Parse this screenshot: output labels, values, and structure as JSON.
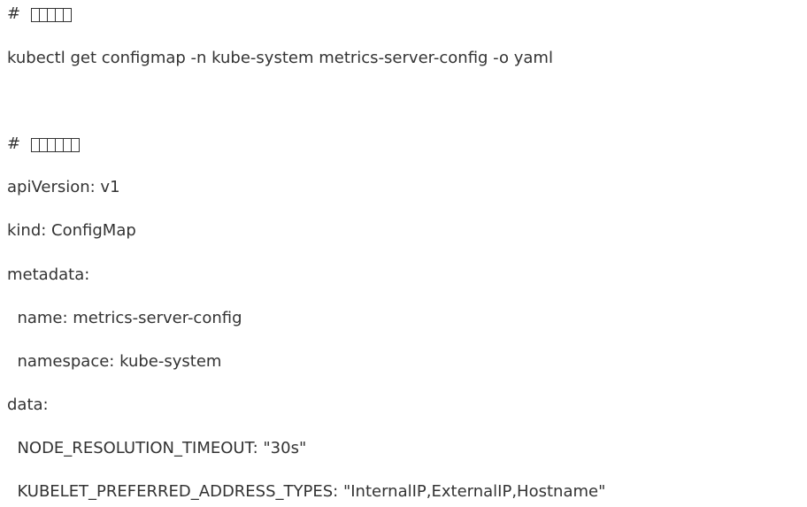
{
  "document": {
    "lines": [
      "# ",
      "kubectl get configmap -n kube-system metrics-server-config -o yaml",
      "",
      "# ",
      "apiVersion: v1",
      "kind: ConfigMap",
      "metadata:",
      "  name: metrics-server-config",
      "  namespace: kube-system",
      "data:",
      "  NODE_RESOLUTION_TIMEOUT: \"30s\"",
      "  KUBELET_PREFERRED_ADDRESS_TYPES: \"InternalIP,ExternalIP,Hostname\""
    ]
  }
}
